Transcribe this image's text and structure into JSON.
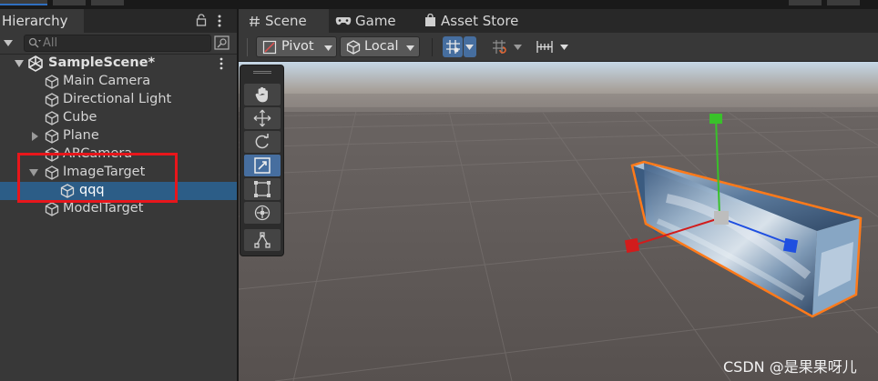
{
  "colors": {
    "selection": "#2c5d87",
    "highlight_box": "#e8161b",
    "active_tool": "#466e9f",
    "gizmo_x": "#d21c1c",
    "gizmo_y": "#39c12a",
    "gizmo_z": "#1f4fe0",
    "outline": "#ff7a1a"
  },
  "hierarchy": {
    "tab_label": "Hierarchy",
    "search_placeholder": "All",
    "scene": {
      "name": "SampleScene*",
      "icon": "unity-scene-icon"
    },
    "items": [
      {
        "label": "Main Camera",
        "icon": "gameobject-cube-icon",
        "expandable": false
      },
      {
        "label": "Directional Light",
        "icon": "gameobject-cube-icon",
        "expandable": false
      },
      {
        "label": "Cube",
        "icon": "gameobject-cube-icon",
        "expandable": false
      },
      {
        "label": "Plane",
        "icon": "gameobject-cube-icon",
        "expandable": true,
        "expanded": false
      },
      {
        "label": "ARCamera",
        "icon": "gameobject-cube-icon",
        "expandable": false
      },
      {
        "label": "ImageTarget",
        "icon": "gameobject-cube-icon",
        "expandable": true,
        "expanded": true
      },
      {
        "label": "qqq",
        "icon": "gameobject-cube-icon",
        "expandable": false,
        "selected": true,
        "child": true
      },
      {
        "label": "ModelTarget",
        "icon": "gameobject-cube-icon",
        "expandable": false
      }
    ]
  },
  "scene_view": {
    "tabs": [
      {
        "label": "Scene",
        "icon": "hash-icon",
        "active": true
      },
      {
        "label": "Game",
        "icon": "gamepad-icon",
        "active": false
      },
      {
        "label": "Asset Store",
        "icon": "shopping-bag-icon",
        "active": false
      }
    ],
    "toolbar": {
      "pivot_label": "Pivot",
      "local_label": "Local"
    },
    "tools": [
      {
        "name": "hand-tool",
        "active": false
      },
      {
        "name": "move-tool",
        "active": false
      },
      {
        "name": "rotate-tool",
        "active": false
      },
      {
        "name": "scale-tool",
        "active": true
      },
      {
        "name": "rect-tool",
        "active": false
      },
      {
        "name": "transform-tool",
        "active": false
      },
      {
        "name": "custom-tool",
        "active": false
      }
    ]
  },
  "watermark": "CSDN @是果果呀儿"
}
